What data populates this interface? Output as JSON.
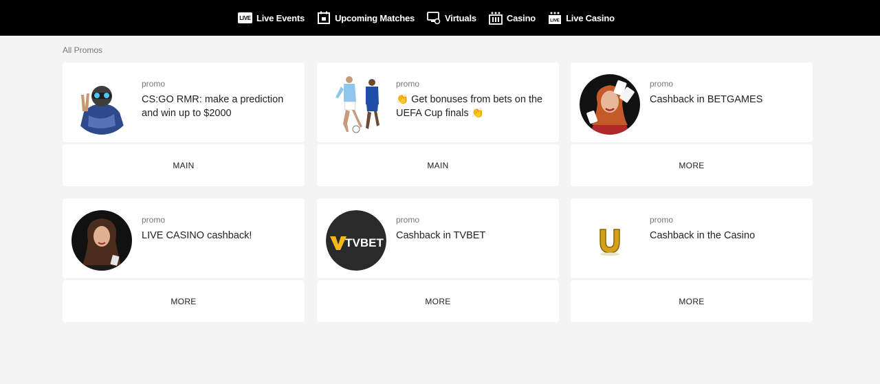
{
  "nav": [
    {
      "label": "Live Events",
      "icon": "live-icon",
      "badge": "LIVE"
    },
    {
      "label": "Upcoming Matches",
      "icon": "calendar-icon"
    },
    {
      "label": "Virtuals",
      "icon": "monitor-icon"
    },
    {
      "label": "Casino",
      "icon": "casino-icon"
    },
    {
      "label": "Live Casino",
      "icon": "live-casino-icon",
      "badge": "LIVE"
    }
  ],
  "section_title": "All Promos",
  "promos": [
    {
      "label": "promo",
      "title": "CS:GO RMR: make a prediction and win up to $2000",
      "action": "MAIN",
      "image": "csgo-soldier"
    },
    {
      "label": "promo",
      "title": "👏 Get bonuses from bets on the UEFA Cup finals 👏",
      "action": "MAIN",
      "image": "football-players"
    },
    {
      "label": "promo",
      "title": "Cashback in BETGAMES",
      "action": "MORE",
      "image": "card-dealer"
    },
    {
      "label": "promo",
      "title": "LIVE CASINO cashback!",
      "action": "MORE",
      "image": "live-dealer"
    },
    {
      "label": "promo",
      "title": "Cashback in TVBET",
      "action": "MORE",
      "image": "tvbet-logo",
      "logo_text": "TVBET"
    },
    {
      "label": "promo",
      "title": "Cashback in the Casino",
      "action": "MORE",
      "image": "golden-horseshoe"
    }
  ]
}
